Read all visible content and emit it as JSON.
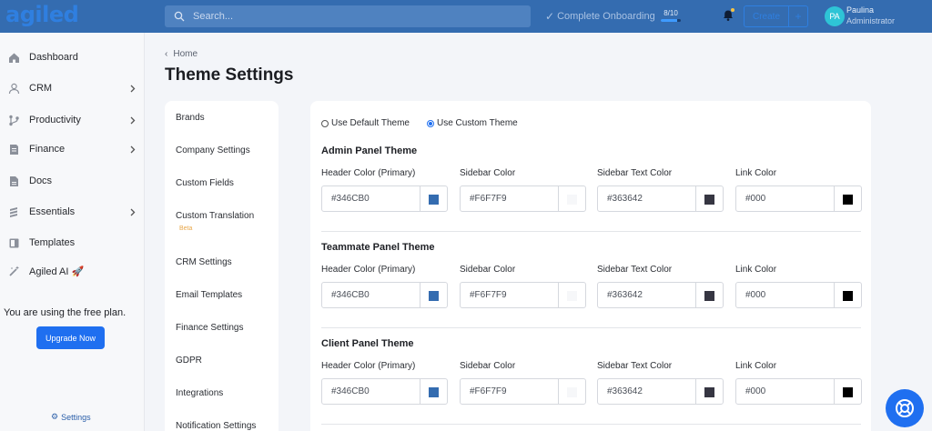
{
  "header": {
    "logo": "agiled",
    "search_placeholder": "Search...",
    "onboarding_label": "Complete Onboarding",
    "onboarding_progress": "8/10",
    "onboarding_fraction": 0.8,
    "create_label": "Create",
    "create_plus": "+",
    "user_initials": "PA",
    "user_name": "Paulina",
    "user_role": "Administrator"
  },
  "sidebar": {
    "items": [
      {
        "label": "Dashboard",
        "icon": "home-icon",
        "chevron": false
      },
      {
        "label": "CRM",
        "icon": "user-icon",
        "chevron": true
      },
      {
        "label": "Productivity",
        "icon": "branch-icon",
        "chevron": true
      },
      {
        "label": "Finance",
        "icon": "invoice-icon",
        "chevron": true
      },
      {
        "label": "Docs",
        "icon": "document-icon",
        "chevron": false
      },
      {
        "label": "Essentials",
        "icon": "layers-icon",
        "chevron": true
      },
      {
        "label": "Templates",
        "icon": "template-icon",
        "chevron": false
      },
      {
        "label": "Agiled AI 🚀",
        "icon": "magic-wand-icon",
        "chevron": false
      }
    ],
    "free_plan_text": "You are using the free plan.",
    "upgrade_label": "Upgrade Now",
    "settings_label": "Settings"
  },
  "breadcrumb": {
    "home": "Home"
  },
  "page_title": "Theme Settings",
  "settings_menu": [
    "Brands",
    "Company Settings",
    "Custom Fields",
    "Custom Translation",
    "CRM Settings",
    "Email Templates",
    "Finance Settings",
    "GDPR",
    "Integrations",
    "Notification Settings"
  ],
  "beta_label": "Beta",
  "theme_mode": {
    "default_label": "Use Default Theme",
    "custom_label": "Use Custom Theme",
    "selected": "custom"
  },
  "field_labels": {
    "header": "Header Color (Primary)",
    "sidebar": "Sidebar Color",
    "sidebar_text": "Sidebar Text Color",
    "link": "Link Color"
  },
  "sections": [
    {
      "title": "Admin Panel Theme",
      "header_color": "#346CB0",
      "sidebar_color": "#F6F7F9",
      "sidebar_text_color": "#363642",
      "link_color": "#000"
    },
    {
      "title": "Teammate Panel Theme",
      "header_color": "#346CB0",
      "sidebar_color": "#F6F7F9",
      "sidebar_text_color": "#363642",
      "link_color": "#000"
    },
    {
      "title": "Client Panel Theme",
      "header_color": "#346CB0",
      "sidebar_color": "#F6F7F9",
      "sidebar_text_color": "#363642",
      "link_color": "#000"
    }
  ],
  "colors": {
    "brand": "#346cb0",
    "accent": "#1f6ff0"
  }
}
